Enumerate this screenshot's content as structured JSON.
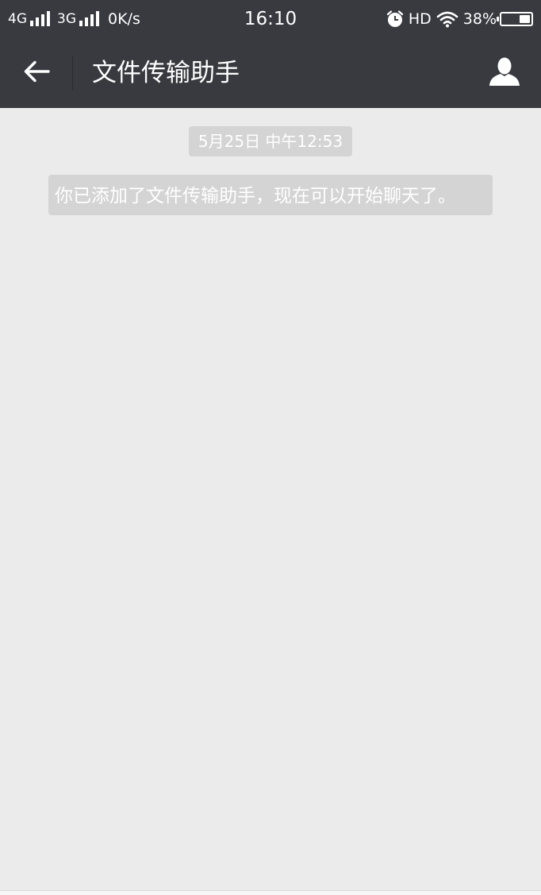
{
  "status_bar": {
    "network1": "4G",
    "network2": "3G",
    "speed": "0K/s",
    "time": "16:10",
    "hd": "HD",
    "battery_text": "38%",
    "battery_level": 0.38
  },
  "header": {
    "title": "文件传输助手",
    "back_icon": "back-arrow-icon",
    "profile_icon": "person-icon"
  },
  "chat": {
    "timestamp": "5月25日 中午12:53",
    "system_message": "你已添加了文件传输助手，现在可以开始聊天了。"
  },
  "colors": {
    "header_bg": "#393a3f",
    "chat_bg": "#ebebeb",
    "bubble_bg": "#d4d4d4"
  }
}
